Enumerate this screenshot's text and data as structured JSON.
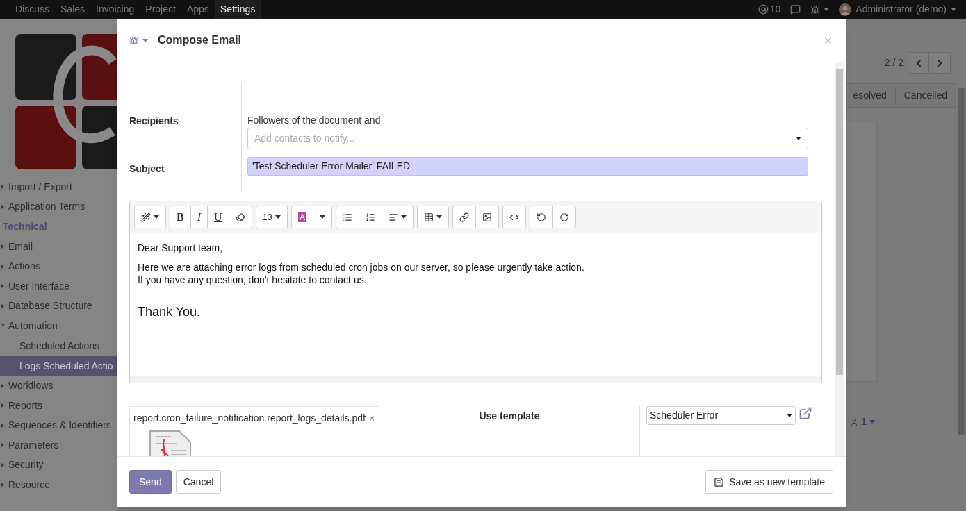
{
  "top_nav": {
    "apps": [
      {
        "label": "Discuss",
        "selected": false
      },
      {
        "label": "Sales",
        "selected": false
      },
      {
        "label": "Invoicing",
        "selected": false
      },
      {
        "label": "Project",
        "selected": false
      },
      {
        "label": "Apps",
        "selected": false
      },
      {
        "label": "Settings",
        "selected": true
      }
    ],
    "mentions": "10",
    "user": "Administrator (demo)"
  },
  "sidebar": {
    "items": [
      {
        "kind": "item",
        "label": "Import / Export",
        "expanded": false,
        "selected": false
      },
      {
        "kind": "item",
        "label": "Application Terms",
        "expanded": false,
        "selected": false
      },
      {
        "kind": "section",
        "label": "Technical"
      },
      {
        "kind": "item",
        "label": "Email",
        "expanded": false,
        "selected": false
      },
      {
        "kind": "item",
        "label": "Actions",
        "expanded": false,
        "selected": false
      },
      {
        "kind": "item",
        "label": "User Interface",
        "expanded": false,
        "selected": false
      },
      {
        "kind": "item",
        "label": "Database Structure",
        "expanded": false,
        "selected": false
      },
      {
        "kind": "item",
        "label": "Automation",
        "expanded": true,
        "selected": false,
        "children": [
          {
            "label": "Scheduled Actions",
            "selected": false
          },
          {
            "label": "Logs Scheduled Actio",
            "selected": true
          }
        ]
      },
      {
        "kind": "item",
        "label": "Workflows",
        "expanded": false,
        "selected": false
      },
      {
        "kind": "item",
        "label": "Reports",
        "expanded": false,
        "selected": false
      },
      {
        "kind": "item",
        "label": "Sequences & Identifiers",
        "expanded": false,
        "selected": false
      },
      {
        "kind": "item",
        "label": "Parameters",
        "expanded": false,
        "selected": false
      },
      {
        "kind": "item",
        "label": "Security",
        "expanded": false,
        "selected": false
      },
      {
        "kind": "item",
        "label": "Resource",
        "expanded": false,
        "selected": false
      }
    ]
  },
  "record": {
    "pager": "2 / 2",
    "stages": [
      {
        "label": "esolved",
        "selected": false
      },
      {
        "label": "Cancelled",
        "selected": false
      }
    ],
    "followers": "1"
  },
  "dialog": {
    "title": "Compose Email",
    "recipients": {
      "label": "Recipients",
      "note": "Followers of the document and",
      "placeholder": "Add contacts to notify..."
    },
    "subject": {
      "label": "Subject",
      "value": "'Test Scheduler Error Mailer' FAILED"
    },
    "toolbar": [
      [
        {
          "kind": "style",
          "caret": true
        }
      ],
      [
        {
          "kind": "bold",
          "text": "B",
          "caret": false
        },
        {
          "kind": "italic",
          "text": "I",
          "caret": false
        },
        {
          "kind": "underline",
          "text": "U",
          "caret": false
        },
        {
          "kind": "eraser",
          "caret": false
        }
      ],
      [
        {
          "kind": "size",
          "text": "13",
          "caret": true
        }
      ],
      [
        {
          "kind": "color",
          "text": "A",
          "caret": false
        },
        {
          "kind": "dropdown",
          "caret": true
        }
      ],
      [
        {
          "kind": "bullets",
          "caret": false
        },
        {
          "kind": "numbers",
          "caret": false
        },
        {
          "kind": "align",
          "caret": true
        }
      ],
      [
        {
          "kind": "table",
          "caret": true
        }
      ],
      [
        {
          "kind": "link",
          "caret": false
        },
        {
          "kind": "image",
          "caret": false
        }
      ],
      [
        {
          "kind": "code",
          "caret": false
        }
      ],
      [
        {
          "kind": "undo",
          "caret": false
        },
        {
          "kind": "redo",
          "caret": false
        }
      ]
    ],
    "body": [
      {
        "kind": "line",
        "text": "Dear Support team,"
      },
      {
        "kind": "line",
        "text": "Here we are attaching error logs from scheduled cron jobs on our server, so please urgently take action."
      },
      {
        "kind": "line",
        "text": "If you have any question, don't hesitate to contact us."
      },
      {
        "kind": "large",
        "text": "Thank You."
      }
    ],
    "attachment": "report.cron_failure_notification.report_logs_details.pdf",
    "template": {
      "label": "Use template",
      "value": "Scheduler Error"
    },
    "buttons": {
      "send": "Send",
      "cancel": "Cancel",
      "save_template": "Save as new template"
    }
  }
}
